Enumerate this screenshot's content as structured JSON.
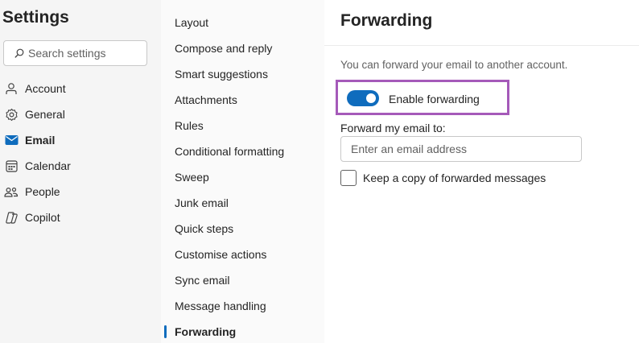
{
  "settings": {
    "title": "Settings",
    "search_placeholder": "Search settings",
    "nav": [
      {
        "label": "Account",
        "icon": "person-icon",
        "active": false
      },
      {
        "label": "General",
        "icon": "gear-icon",
        "active": false
      },
      {
        "label": "Email",
        "icon": "mail-icon",
        "active": true
      },
      {
        "label": "Calendar",
        "icon": "calendar-icon",
        "active": false
      },
      {
        "label": "People",
        "icon": "people-icon",
        "active": false
      },
      {
        "label": "Copilot",
        "icon": "copilot-icon",
        "active": false
      }
    ]
  },
  "email_menu": {
    "items": [
      "Layout",
      "Compose and reply",
      "Smart suggestions",
      "Attachments",
      "Rules",
      "Conditional formatting",
      "Sweep",
      "Junk email",
      "Quick steps",
      "Customise actions",
      "Sync email",
      "Message handling",
      "Forwarding"
    ],
    "active_item": "Forwarding"
  },
  "forwarding": {
    "title": "Forwarding",
    "description": "You can forward your email to another account.",
    "toggle_label": "Enable forwarding",
    "toggle_on": true,
    "field_label": "Forward my email to:",
    "email_placeholder": "Enter an email address",
    "email_value": "",
    "keep_copy_label": "Keep a copy of forwarded messages",
    "keep_copy_checked": false
  },
  "colors": {
    "accent": "#0f6cbd",
    "highlight_border": "#a55ab9"
  }
}
